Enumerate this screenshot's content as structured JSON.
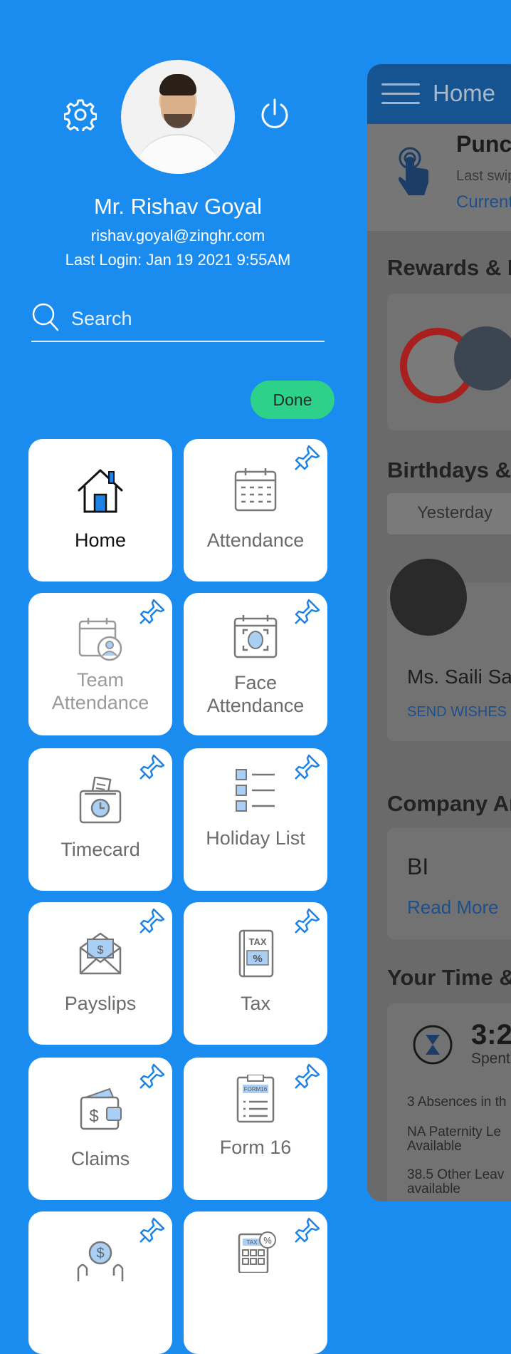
{
  "profile": {
    "name": "Mr. Rishav Goyal",
    "email": "rishav.goyal@zinghr.com",
    "last_login": "Last Login: Jan 19 2021 9:55AM"
  },
  "search": {
    "placeholder": "Search"
  },
  "done_label": "Done",
  "tiles": [
    {
      "label": "Home",
      "icon": "home-icon"
    },
    {
      "label": "Attendance",
      "icon": "calendar-icon"
    },
    {
      "label": "Team Attendance",
      "icon": "team-calendar-icon"
    },
    {
      "label": "Face Attendance",
      "icon": "face-scan-icon"
    },
    {
      "label": "Timecard",
      "icon": "timecard-icon"
    },
    {
      "label": "Holiday List",
      "icon": "list-icon"
    },
    {
      "label": "Payslips",
      "icon": "payslip-envelope-icon"
    },
    {
      "label": "Tax",
      "icon": "tax-book-icon"
    },
    {
      "label": "Claims",
      "icon": "wallet-icon"
    },
    {
      "label": "Form 16",
      "icon": "form16-icon"
    }
  ],
  "icon_texts": {
    "tax": "TAX",
    "percent": "%",
    "form16": "FORM16",
    "dollar": "$"
  },
  "preview": {
    "header_title": "Home",
    "punch_title": "Punch",
    "punch_sub": "Last swipe",
    "punch_link": "Current",
    "rewards_title": "Rewards & R",
    "birthdays_title": "Birthdays &",
    "tab_yesterday": "Yesterday",
    "person_name": "Ms. Saili Sar",
    "send_wishes": "SEND WISHES",
    "company_title": "Company An",
    "company_item": "BI",
    "read_more": "Read More",
    "time_title": "Your Time &",
    "time_value": "3:2",
    "time_sub": "Spent",
    "absences": "3 Absences in th",
    "paternity_1": "NA Paternity Le",
    "paternity_2": "Available",
    "other_leave_1": "38.5 Other Leav",
    "other_leave_2": "available"
  },
  "colors": {
    "background": "#1a8cf0",
    "done_button": "#2ed18a",
    "icon_blue": "#1d82e6",
    "tile_bg": "#ffffff"
  }
}
